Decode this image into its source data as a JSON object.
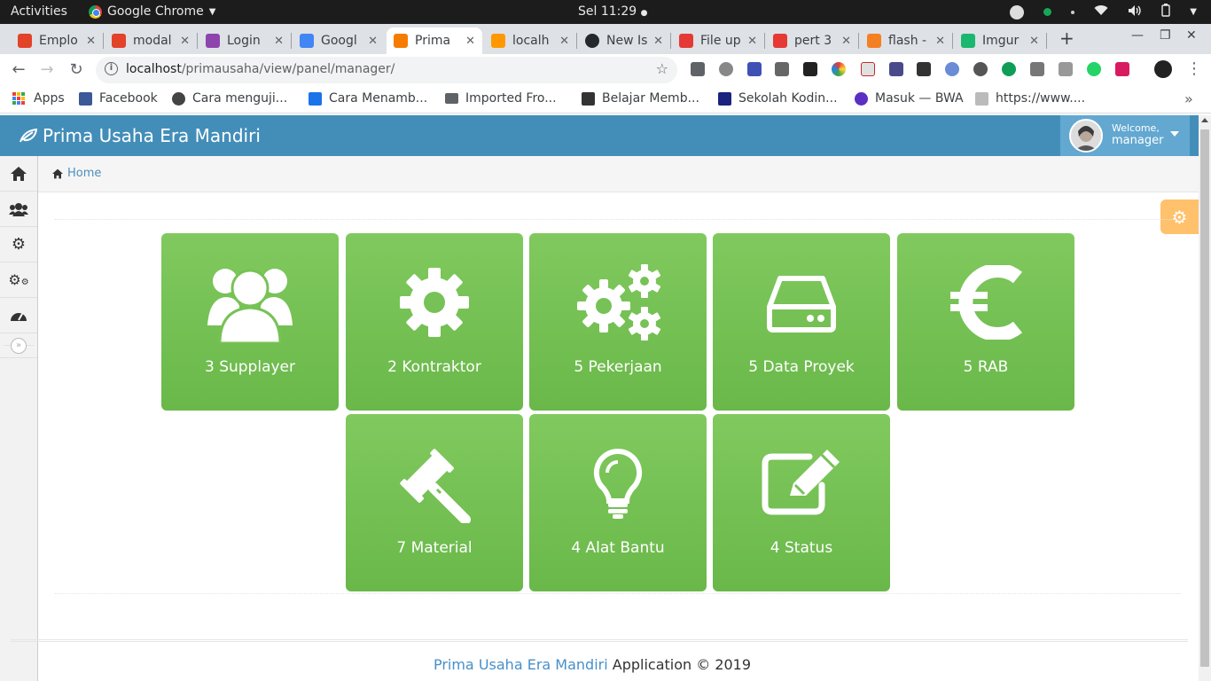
{
  "os_bar": {
    "activities": "Activities",
    "app_name": "Google Chrome",
    "clock": "Sel 11:29"
  },
  "tabs": [
    {
      "title": "Emplo",
      "color": "#e24329"
    },
    {
      "title": "modal",
      "color": "#e24329"
    },
    {
      "title": "Login",
      "color": "#8e44ad"
    },
    {
      "title": "Googl",
      "color": "#4285f4"
    },
    {
      "title": "Prima",
      "color": "#f57c00",
      "active": true
    },
    {
      "title": "localh",
      "color": "#ff9800"
    },
    {
      "title": "New Is",
      "color": "#24292e"
    },
    {
      "title": "File up",
      "color": "#e53935"
    },
    {
      "title": "pert 3",
      "color": "#e53935"
    },
    {
      "title": "flash -",
      "color": "#f48024"
    },
    {
      "title": "Imgur",
      "color": "#1bb76e"
    }
  ],
  "toolbar": {
    "url_host": "localhost",
    "url_path": "/primausaha/view/panel/manager/"
  },
  "bookmarks": [
    {
      "label": "Apps",
      "type": "apps"
    },
    {
      "label": "Facebook",
      "color": "#3b5998"
    },
    {
      "label": "Cara menguji...",
      "color": "#444"
    },
    {
      "label": "Cara Menamb...",
      "color": "#1a73e8"
    },
    {
      "label": "Imported Fro...",
      "color": "#5f6368"
    },
    {
      "label": "Belajar Memb...",
      "color": "#333"
    },
    {
      "label": "Sekolah Kodin...",
      "color": "#1a237e"
    },
    {
      "label": "Masuk — BWA",
      "color": "#5c2ec4"
    },
    {
      "label": "https://www....",
      "color": "#888"
    }
  ],
  "header": {
    "brand": "Prima Usaha Era Mandiri",
    "welcome": "Welcome,",
    "username": "manager"
  },
  "breadcrumb": {
    "home": "Home"
  },
  "tiles": [
    {
      "label": "3 Supplayer",
      "icon": "users-icon"
    },
    {
      "label": "2 Kontraktor",
      "icon": "gear-icon"
    },
    {
      "label": "5 Pekerjaan",
      "icon": "gears-icon"
    },
    {
      "label": "5 Data Proyek",
      "icon": "hdd-icon"
    },
    {
      "label": "5 RAB",
      "icon": "euro-icon"
    },
    {
      "label": "7 Material",
      "icon": "gavel-icon"
    },
    {
      "label": "4 Alat Bantu",
      "icon": "lightbulb-icon"
    },
    {
      "label": "4 Status",
      "icon": "edit-icon"
    }
  ],
  "footer": {
    "brand": "Prima Usaha Era Mandiri",
    "suffix": " Application © 2019"
  },
  "colors": {
    "header_bg": "#438eb9",
    "tile_green": "#77c256",
    "settings_orange": "#ffb752"
  }
}
